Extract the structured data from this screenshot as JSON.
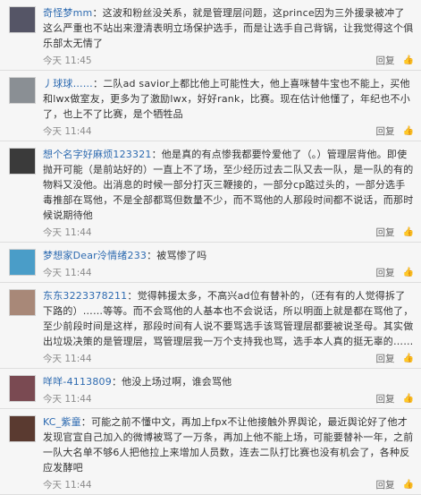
{
  "comments": [
    {
      "user": "奇怪梦mm",
      "text": "：这波和粉丝没关系，就是管理层问题，这prince因为三外援录被冲了这么严重也不站出来澄清表明立场保护选手，而是让选手自己背锅，让我觉得这个俱乐部太无情了",
      "time": "今天 11:45",
      "avatar_color": "#555566"
    },
    {
      "user": "丿球球……",
      "text": "：二队ad savior上都比他上可能性大，他上喜咪替牛宝也不能上，买他和lwx做室友，更多为了激励lwx，好好rank，比赛。现在估计他懂了，年纪也不小了，也上不了比赛，是个牺牲品",
      "time": "今天 11:44",
      "avatar_color": "#8a8f94"
    },
    {
      "user": "想个名字好麻烦123321",
      "text": "：他是真的有点惨我都要怜爱他了（。）管理层背他。即使抛开可能（是前站好的）一直上不了场，至少经历过去二队又去一队，是一队的有的物料又没他。出消息的时候一部分打灭三鞭接的，一部分cp踮过头的，一部分选手毒推部在骂他，不是全部都骂但数量不少，而不骂他的人那段时间都不说话，而那时候说期待他",
      "time": "今天 11:44",
      "avatar_color": "#3a3a3a"
    },
    {
      "user": "梦想家Dear泠情绪233",
      "text": "：被骂惨了吗",
      "time": "今天 11:44",
      "avatar_color": "#4a9dc8"
    },
    {
      "user": "东东3223378211",
      "text": "：觉得韩援太多，不高兴ad位有替补的，（还有有的人觉得拆了下路的）……等等。而不会骂他的人基本也不会说话，所以明面上就是都在骂他了，至少前段时间是这样，那段时间有人说不要骂选手该骂管理层都要被说圣母。其实做出垃圾决策的是管理层，骂管理层我一万个支持我也骂，选手本人真的挺无辜的……",
      "time": "今天 11:44",
      "avatar_color": "#a88878"
    },
    {
      "user": "咩咩-4113809",
      "text": "：他没上场过啊，谁会骂他",
      "time": "今天 11:44",
      "avatar_color": "#7a4a52"
    },
    {
      "user": "KC_紫童",
      "text": "：可能之前不懂中文，再加上fpx不让他接触外界舆论，最近舆论好了他才发现官宣自己加入的微博被骂了一万条，再加上他不能上场，可能要替补一年，之前一队大名单不够6人把他拉上来增加人员数，连去二队打比赛也没有机会了，各种反应发酵吧",
      "time": "今天 11:44",
      "avatar_color": "#5a3a30"
    }
  ],
  "labels": {
    "reply": "回复",
    "like": "赞"
  }
}
